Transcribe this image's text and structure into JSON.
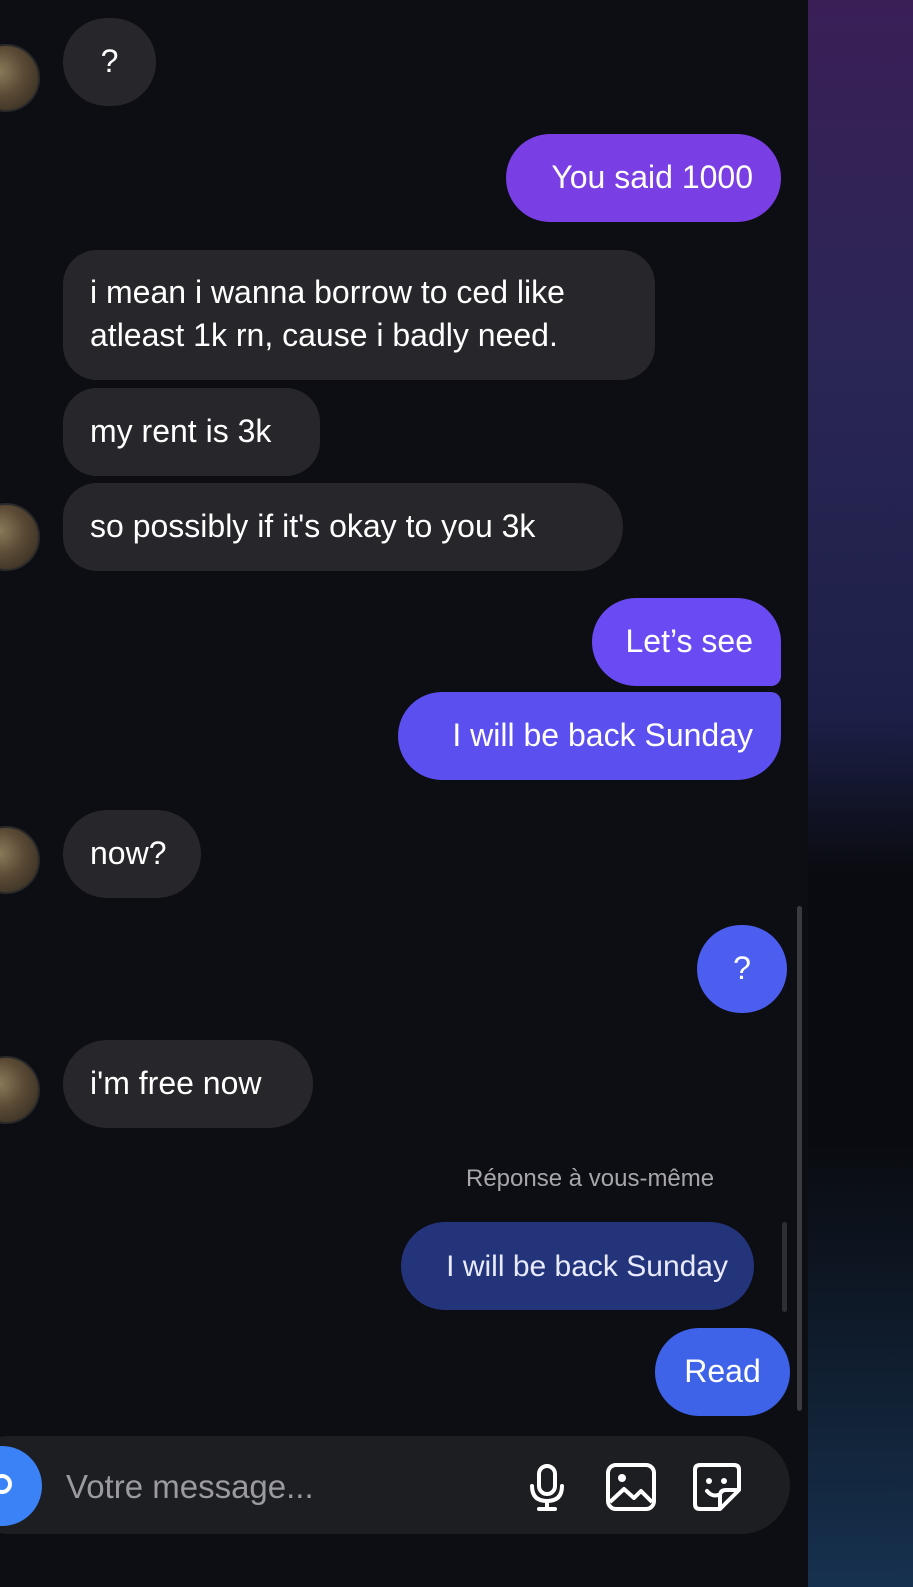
{
  "conversation": {
    "messages": [
      {
        "direction": "incoming",
        "text": "?"
      },
      {
        "direction": "outgoing",
        "text": "You said 1000"
      },
      {
        "direction": "incoming",
        "lines": [
          "i mean i wanna borrow to ced like",
          "atleast 1k rn, cause i badly need."
        ]
      },
      {
        "direction": "incoming",
        "text": "my rent is 3k"
      },
      {
        "direction": "incoming",
        "text": "so possibly if it's okay to you 3k"
      },
      {
        "direction": "outgoing",
        "text": "Let’s see"
      },
      {
        "direction": "outgoing",
        "text": "I will be back Sunday"
      },
      {
        "direction": "incoming",
        "text": "now?"
      },
      {
        "direction": "outgoing",
        "text": "?"
      },
      {
        "direction": "incoming",
        "text": "i'm free now"
      },
      {
        "direction": "outgoing",
        "reply_label": "Réponse à vous-même",
        "quoted_text": "I will be back Sunday",
        "text": "Read"
      }
    ]
  },
  "composer": {
    "placeholder": "Votre message...",
    "icons": [
      "camera-icon",
      "microphone-icon",
      "image-icon",
      "sticker-icon"
    ]
  },
  "colors": {
    "background": "#0d0e13",
    "incoming_bubble": "#26262b",
    "outgoing_purple": "#7a3fe4",
    "outgoing_indigo": "#5b4ff0",
    "outgoing_blue": "#3e63e8",
    "quoted_bubble": "#23347a",
    "camera_button": "#3b82f6"
  }
}
